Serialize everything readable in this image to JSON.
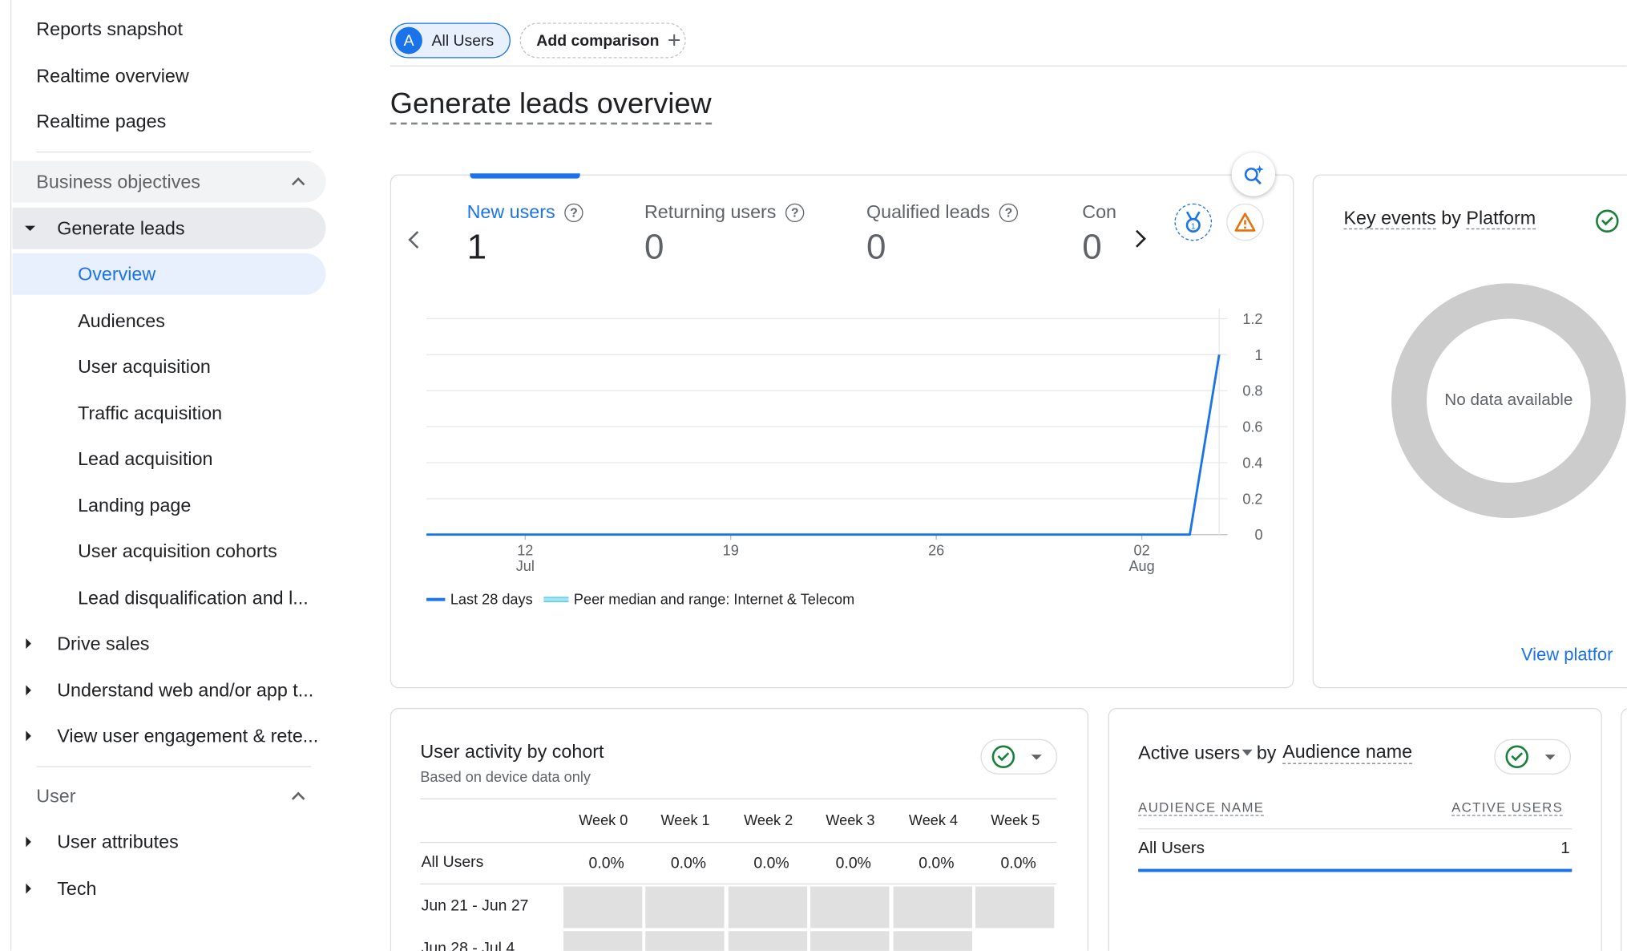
{
  "sidebar": {
    "items": [
      {
        "label": "Reports snapshot"
      },
      {
        "label": "Realtime overview"
      },
      {
        "label": "Realtime pages"
      }
    ],
    "sections": [
      {
        "label": "Business objectives"
      },
      {
        "label": "User"
      }
    ],
    "generate_leads": {
      "label": "Generate leads",
      "children": [
        {
          "label": "Overview"
        },
        {
          "label": "Audiences"
        },
        {
          "label": "User acquisition"
        },
        {
          "label": "Traffic acquisition"
        },
        {
          "label": "Lead acquisition"
        },
        {
          "label": "Landing page"
        },
        {
          "label": "User acquisition cohorts"
        },
        {
          "label": "Lead disqualification and l..."
        }
      ]
    },
    "collapsed_groups": [
      {
        "label": "Drive sales"
      },
      {
        "label": "Understand web and/or app t..."
      },
      {
        "label": "View user engagement & rete..."
      }
    ],
    "user_groups": [
      {
        "label": "User attributes"
      },
      {
        "label": "Tech"
      }
    ]
  },
  "header": {
    "segment_avatar": "A",
    "segment_label": "All Users",
    "add_comparison": "Add comparison",
    "page_title": "Generate leads overview"
  },
  "metrics": [
    {
      "label": "New users",
      "value": "1"
    },
    {
      "label": "Returning users",
      "value": "0"
    },
    {
      "label": "Qualified leads",
      "value": "0"
    },
    {
      "label": "Con",
      "value": "0"
    }
  ],
  "chart_data": {
    "type": "line",
    "x_ticks": [
      {
        "day": "12",
        "month": "Jul"
      },
      {
        "day": "19",
        "month": ""
      },
      {
        "day": "26",
        "month": ""
      },
      {
        "day": "02",
        "month": "Aug"
      }
    ],
    "y_ticks": [
      "1.2",
      "1",
      "0.8",
      "0.6",
      "0.4",
      "0.2",
      "0"
    ],
    "ylim": [
      0,
      1.2
    ],
    "series": [
      {
        "name": "Last 28 days",
        "color": "#1a73e8",
        "values": [
          0,
          0,
          0,
          0,
          0,
          0,
          0,
          0,
          0,
          0,
          0,
          0,
          0,
          0,
          0,
          0,
          0,
          0,
          0,
          0,
          0,
          0,
          0,
          0,
          0,
          0,
          0,
          1
        ]
      }
    ],
    "legend": [
      {
        "label": "Last 28 days",
        "color": "#1a73e8"
      },
      {
        "label": "Peer median and range: Internet & Telecom",
        "color": "#4ecde6"
      }
    ]
  },
  "key_events": {
    "title_part1": "Key events",
    "title_by": "by",
    "title_part2": "Platform",
    "empty_text": "No data available",
    "view_link": "View platfor"
  },
  "cohort": {
    "title": "User activity by cohort",
    "subtitle": "Based on device data only",
    "weeks": [
      "Week 0",
      "Week 1",
      "Week 2",
      "Week 3",
      "Week 4",
      "Week 5"
    ],
    "rows": [
      {
        "label": "All Users",
        "values": [
          "0.0%",
          "0.0%",
          "0.0%",
          "0.0%",
          "0.0%",
          "0.0%"
        ]
      },
      {
        "label": "Jun 21 - Jun 27"
      },
      {
        "label": "Jun 28 - Jul 4"
      }
    ]
  },
  "audience": {
    "metric": "Active users",
    "by": "by",
    "dimension": "Audience name",
    "col_name": "AUDIENCE NAME",
    "col_users": "ACTIVE USERS",
    "rows": [
      {
        "name": "All Users",
        "value": "1"
      }
    ]
  }
}
